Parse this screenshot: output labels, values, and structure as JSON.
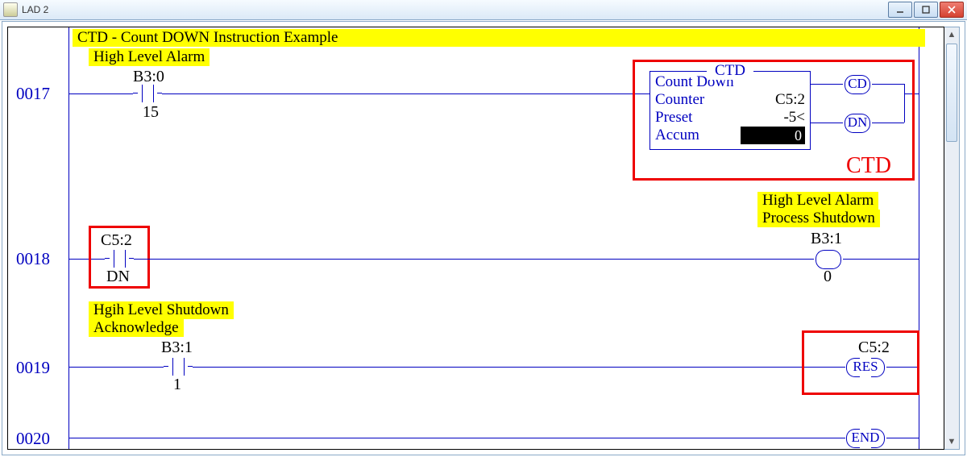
{
  "window": {
    "title": "LAD 2"
  },
  "rung17": {
    "num": "0017",
    "title": "CTD - Count DOWN Instruction Example",
    "input_desc": "High Level Alarm",
    "input_addr": "B3:0",
    "input_bit": "15",
    "ctd": {
      "heading": "CTD",
      "l1": "Count Down",
      "l2": "Counter",
      "v2": "C5:2",
      "l3": "Preset",
      "v3": "-5<",
      "l4": "Accum",
      "v4": "0"
    },
    "cd_tag": "CD",
    "dn_tag": "DN",
    "red_label": "CTD"
  },
  "rung18": {
    "num": "0018",
    "in_addr": "C5:2",
    "in_bit": "DN",
    "out_desc1": "High Level Alarm",
    "out_desc2": "Process Shutdown",
    "out_addr": "B3:1",
    "out_bit": "0"
  },
  "rung19": {
    "num": "0019",
    "in_desc1": "Hgih Level Shutdown",
    "in_desc2": "Acknowledge",
    "in_addr": "B3:1",
    "in_bit": "1",
    "out_addr": "C5:2",
    "out_tag": "RES"
  },
  "rung20": {
    "num": "0020",
    "end": "END"
  }
}
